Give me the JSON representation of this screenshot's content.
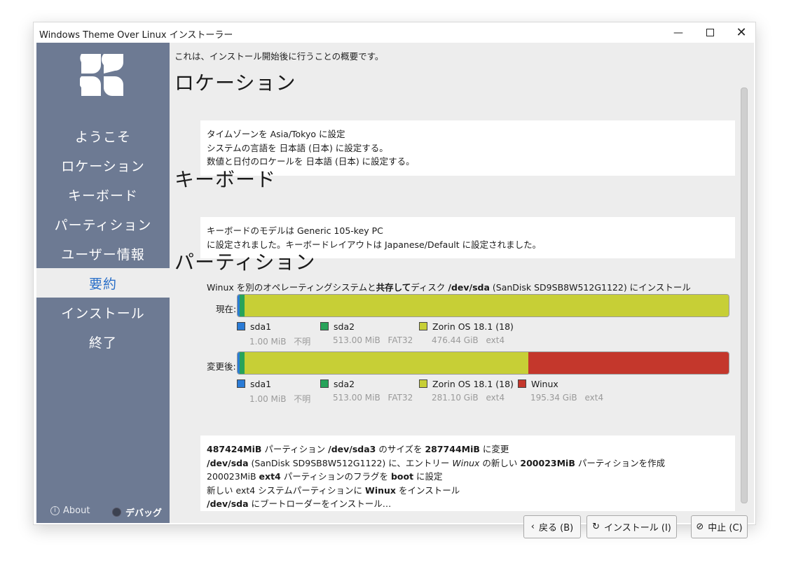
{
  "window": {
    "title": "Windows Theme Over Linux インストーラー"
  },
  "sidebar": {
    "items": [
      {
        "label": "ようこそ"
      },
      {
        "label": "ロケーション"
      },
      {
        "label": "キーボード"
      },
      {
        "label": "パーティション"
      },
      {
        "label": "ユーザー情報"
      },
      {
        "label": "要約",
        "active": true
      },
      {
        "label": "インストール"
      },
      {
        "label": "終了"
      }
    ],
    "about_label": "About",
    "debug_label": "デバッグ"
  },
  "content": {
    "intro": "これは、インストール開始後に行うことの概要です。",
    "location": {
      "heading": "ロケーション",
      "lines": [
        "タイムゾーンを Asia/Tokyo に設定",
        "システムの言語を 日本語 (日本) に設定する。",
        "数値と日付のロケールを 日本語 (日本) に設定する。"
      ]
    },
    "keyboard": {
      "heading": "キーボード",
      "lines": [
        "キーボードのモデルは Generic 105-key PC",
        "に設定されました。キーボードレイアウトは Japanese/Default に設定されました。"
      ]
    },
    "partition": {
      "heading": "パーティション",
      "desc_prefix": "Winux を別のオペレーティングシステムと",
      "desc_bold1": "共存して",
      "desc_mid": "ディスク ",
      "desc_bold2": "/dev/sda",
      "desc_suffix": " (SanDisk SD9SB8W512G1122) にインストール",
      "current_label": "現在:",
      "after_label": "変更後:",
      "current": {
        "segments": [
          {
            "name": "sda1",
            "size": "1.00 MiB",
            "fs": "不明",
            "color": "#2a7bd6",
            "fraction": 0.001
          },
          {
            "name": "sda2",
            "size": "513.00 MiB",
            "fs": "FAT32",
            "color": "#27a35a",
            "fraction": 0.01
          },
          {
            "name": "Zorin OS 18.1 (18)",
            "size": "476.44 GiB",
            "fs": "ext4",
            "color": "#c7cf36",
            "fraction": 0.989
          }
        ]
      },
      "after": {
        "segments": [
          {
            "name": "sda1",
            "size": "1.00 MiB",
            "fs": "不明",
            "color": "#2a7bd6",
            "fraction": 0.001
          },
          {
            "name": "sda2",
            "size": "513.00 MiB",
            "fs": "FAT32",
            "color": "#27a35a",
            "fraction": 0.01
          },
          {
            "name": "Zorin OS 18.1 (18)",
            "size": "281.10 GiB",
            "fs": "ext4",
            "color": "#c7cf36",
            "fraction": 0.58
          },
          {
            "name": "Winux",
            "size": "195.34 GiB",
            "fs": "ext4",
            "color": "#c4372c",
            "fraction": 0.409
          }
        ]
      },
      "ops": {
        "l1_b1": "487424MiB",
        "l1_t1": " パーティション ",
        "l1_b2": "/dev/sda3",
        "l1_t2": " のサイズを ",
        "l1_b3": "287744MiB",
        "l1_t3": " に変更",
        "l2_b1": "/dev/sda",
        "l2_t1": " (SanDisk SD9SB8W512G1122) に、エントリー ",
        "l2_i1": "Winux",
        "l2_t2": " の新しい ",
        "l2_b2": "200023MiB",
        "l2_t3": " パーティションを作成",
        "l3_t1": "200023MiB ",
        "l3_b1": "ext4",
        "l3_t2": " パーティションのフラグを ",
        "l3_b2": "boot",
        "l3_t3": " に設定",
        "l4_t1": "新しい ext4 システムパーティションに ",
        "l4_b1": "Winux",
        "l4_t2": " をインストール",
        "l5_b1": "/dev/sda",
        "l5_t1": " にブートローダーをインストール…"
      }
    }
  },
  "buttons": {
    "back": "戻る (B)",
    "install": "インストール (I)",
    "cancel": "中止 (C)"
  }
}
